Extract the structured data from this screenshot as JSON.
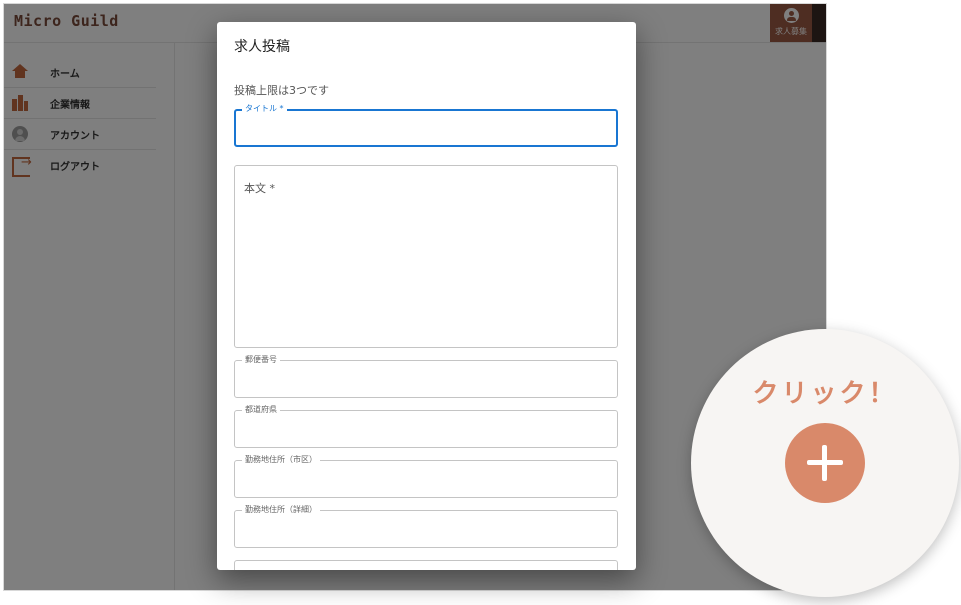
{
  "app": {
    "brand": "Micro Guild",
    "top_action_label": "求人募集"
  },
  "sidebar": {
    "items": [
      {
        "label": "ホーム",
        "icon": "home-icon"
      },
      {
        "label": "企業情報",
        "icon": "building-icon"
      },
      {
        "label": "アカウント",
        "icon": "account-icon"
      },
      {
        "label": "ログアウト",
        "icon": "logout-icon"
      }
    ]
  },
  "dialog": {
    "title": "求人投稿",
    "note": "投稿上限は3つです",
    "fields": {
      "title": {
        "label": "タイトル *",
        "value": ""
      },
      "body": {
        "placeholder": "本文 *",
        "value": ""
      },
      "postal_code": {
        "label": "郵便番号",
        "value": ""
      },
      "prefecture": {
        "label": "都道府県",
        "value": ""
      },
      "city": {
        "label": "勤務地住所（市区）",
        "value": ""
      },
      "address_detail": {
        "label": "勤務地住所（詳細）",
        "value": ""
      }
    }
  },
  "callout": {
    "text": "クリック！",
    "button_icon": "plus-icon"
  },
  "colors": {
    "brand": "#7a4b3a",
    "accent": "#c2683e",
    "focus": "#1976d2",
    "callout": "#d9896a"
  }
}
